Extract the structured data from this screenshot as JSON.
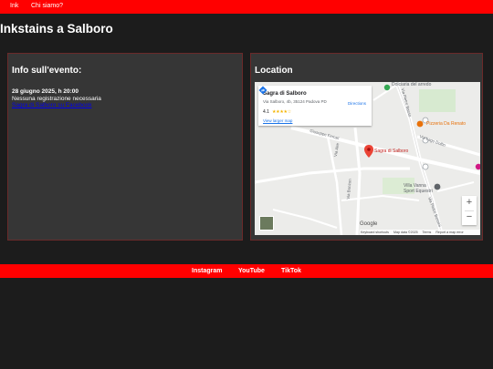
{
  "nav": {
    "items": [
      "Ink",
      "Chi siamo?"
    ]
  },
  "page": {
    "title": "Inkstains a Salboro"
  },
  "info": {
    "heading": "Info sull'evento:",
    "date": "28 giugno 2025, h 20:00",
    "note": "Nessuna registrazione necessaria",
    "link": "Sagra di Salboro su Facebook"
  },
  "location": {
    "heading": "Location",
    "map": {
      "place_name": "Sagra di Salboro",
      "address": "Via Salboro, 4b, 35124 Padova PD",
      "rating": "4.1",
      "stars": "★★★★☆",
      "view_larger": "View larger map",
      "directions": "Directions",
      "pin_label": "Sagra di Salboro",
      "poi_pizzeria": "Pizzeria Da Renato",
      "poi_villa": "Villa Vanna\nSport Equestri",
      "poi_top": "Dolciaria del arredo",
      "streets": {
        "via_pietro_basso": "Via Pietro Basso",
        "via_lago_dolfin": "Via Lago Dolfin",
        "via_bonzon": "Via Bonzon",
        "via_giuseppe_ferrari": "Giuseppe Ferrari",
        "via_aire": "Via Aire",
        "via_pietro_bassini": "Via Pietro Bassini"
      },
      "zoom_in": "+",
      "zoom_out": "−",
      "google": "Google",
      "footer": [
        "Keyboard shortcuts",
        "Map data ©2025",
        "Terms",
        "Report a map error"
      ]
    }
  },
  "footer": {
    "links": [
      "Instagram",
      "YouTube",
      "TikTok"
    ]
  },
  "colors": {
    "accent": "#ff0000",
    "background": "#1c1c1c",
    "card": "#363636",
    "card_border": "#6b2a2a",
    "link": "#0000ee"
  }
}
